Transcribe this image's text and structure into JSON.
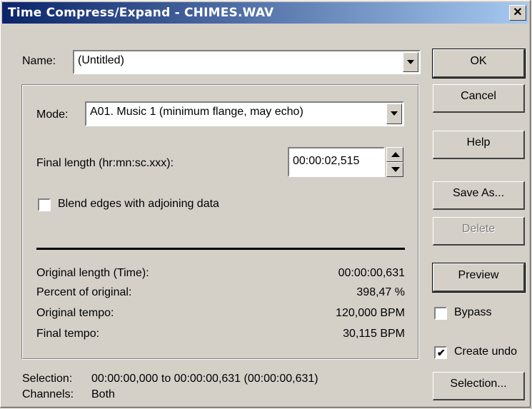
{
  "window": {
    "title": "Time Compress/Expand - CHIMES.WAV",
    "close_glyph": "✕"
  },
  "name_field": {
    "label": "Name:",
    "value": "(Untitled)"
  },
  "mode_field": {
    "label": "Mode:",
    "value": "A01. Music 1 (minimum flange, may echo)"
  },
  "final_length": {
    "label": "Final length (hr:mn:sc.xxx):",
    "value": "00:00:02,515"
  },
  "blend_checkbox": {
    "label": "Blend edges with adjoining data",
    "checked": false
  },
  "stats": [
    {
      "label": "Original length (Time):",
      "value": "00:00:00,631"
    },
    {
      "label": "Percent of original:",
      "value": "398,47 %"
    },
    {
      "label": "Original tempo:",
      "value": "120,000 BPM"
    },
    {
      "label": "Final tempo:",
      "value": "30,115 BPM"
    }
  ],
  "buttons": {
    "ok": "OK",
    "cancel": "Cancel",
    "help": "Help",
    "save_as": "Save As...",
    "delete": "Delete",
    "preview": "Preview",
    "selection": "Selection..."
  },
  "bypass_checkbox": {
    "label": "Bypass",
    "checked": false
  },
  "create_undo_checkbox": {
    "label": "Create undo",
    "checked": true
  },
  "footer": {
    "selection_label": "Selection:",
    "selection_value": "00:00:00,000 to 00:00:00,631 (00:00:00,631)",
    "channels_label": "Channels:",
    "channels_value": "Both"
  }
}
